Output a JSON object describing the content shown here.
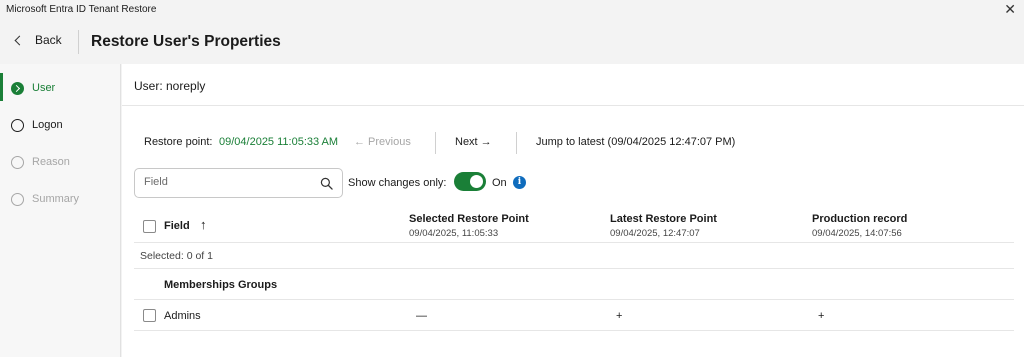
{
  "window": {
    "title": "Microsoft Entra ID Tenant Restore",
    "close_glyph": "✕"
  },
  "header": {
    "back_label": "Back",
    "title": "Restore User's Properties"
  },
  "sidebar": {
    "steps": [
      {
        "label": "User",
        "state": "active"
      },
      {
        "label": "Logon",
        "state": "normal"
      },
      {
        "label": "Reason",
        "state": "disabled"
      },
      {
        "label": "Summary",
        "state": "disabled"
      }
    ]
  },
  "user": {
    "label": "User: noreply"
  },
  "restore": {
    "label": "Restore point:",
    "value": "09/04/2025 11:05:33 AM",
    "previous_label": "←  Previous",
    "next_label": "Next  →",
    "jump_label": "Jump to latest (09/04/2025 12:47:07 PM)"
  },
  "filter": {
    "search_placeholder": "Field",
    "toggle_label": "Show changes only:",
    "toggle_state": "On",
    "toggle_on": true,
    "info_glyph": "i"
  },
  "table": {
    "columns": [
      {
        "name": "Field",
        "sort_glyph": "↑"
      },
      {
        "name": "Selected Restore Point",
        "date": "09/04/2025, 11:05:33"
      },
      {
        "name": "Latest Restore Point",
        "date": "09/04/2025, 12:47:07"
      },
      {
        "name": "Production record",
        "date": "09/04/2025, 14:07:56"
      }
    ],
    "selected_text": "Selected:  0 of 1",
    "group": "Memberships Groups",
    "rows": [
      {
        "field": "Admins",
        "selected": "—",
        "latest": "+",
        "production": "+"
      }
    ]
  },
  "colors": {
    "accent": "#1a7f37",
    "info": "#0f6cbd",
    "disabled": "#a6a6a6"
  }
}
